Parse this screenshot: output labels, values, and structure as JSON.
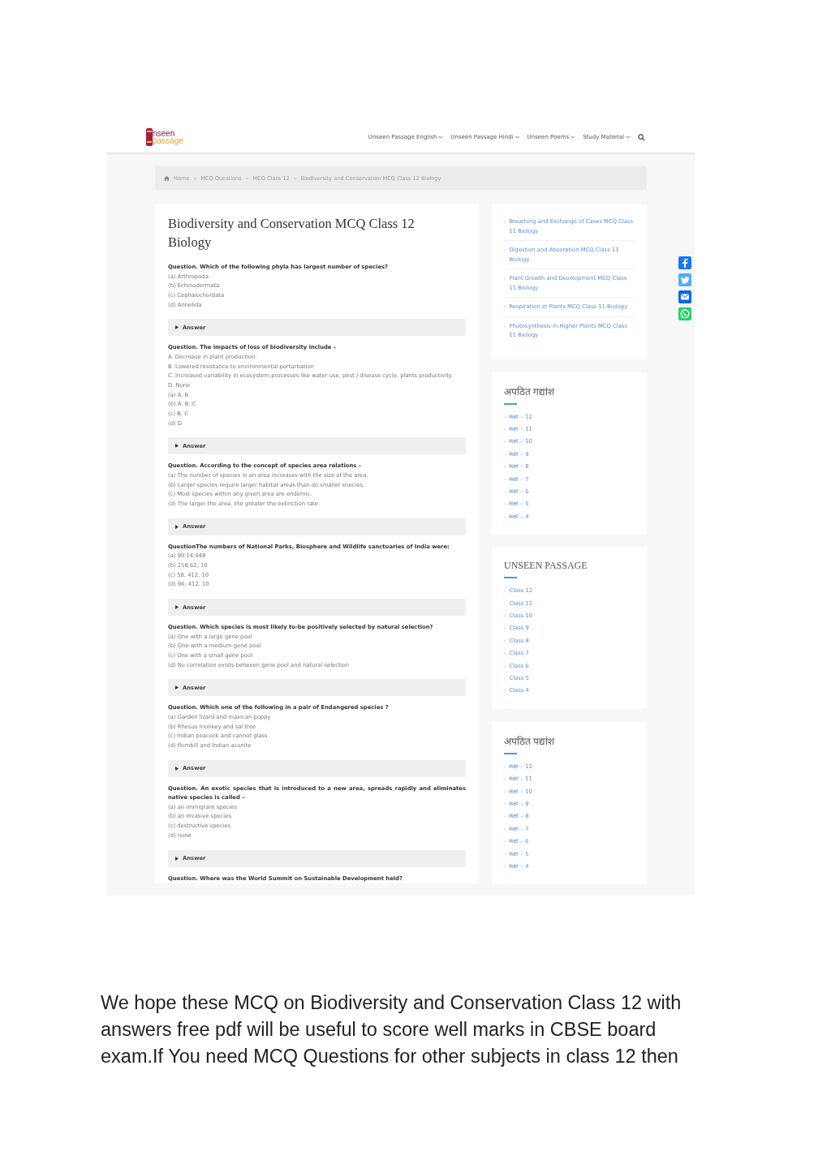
{
  "logo": {
    "part_1": "nseen",
    "part_2": "passage"
  },
  "nav": [
    {
      "label": "Unseen Passage English"
    },
    {
      "label": "Unseen Passage Hindi"
    },
    {
      "label": "Unseen Poems"
    },
    {
      "label": "Study Material"
    }
  ],
  "breadcrumb": {
    "separator": "»",
    "items": [
      "Home",
      "MCQ Questions",
      "MCQ Class 12",
      "Biodiversity and Conservation MCQ Class 12 Biology"
    ]
  },
  "article": {
    "title": "Biodiversity and Conservation MCQ Class 12 Biology",
    "questions": [
      {
        "question": "Question. Which of the following phyla has largest number of species?",
        "options": [
          "(a) Arthropoda",
          "(b) Echinodermata",
          "(c) Cephalochordata",
          "(d) Annelida"
        ],
        "answer_label": "Answer"
      },
      {
        "question": "Question. The impacts of loss of biodiversity include –",
        "options": [
          "A. Decrease in plant production.",
          "B. Lowered resistance to environmental perturbation",
          "C. Increased variability in ecosystem processes like water use, pest / disease cycle, plants productivity.",
          "D. None",
          "(a) A, B",
          "(b) A, B, C",
          "(c) B, C",
          "(d) D"
        ],
        "answer_label": "Answer"
      },
      {
        "question": "Question. According to the concept of species area relations –",
        "options": [
          "(a) The number of species in an area increases with the size of the area.",
          "(b) Larger species require larger habitat areas than do smaller snecies.",
          "(c) Most species within any given area are endemic.",
          "(d) The larger the area, the greater the extinction rate."
        ],
        "answer_label": "Answer"
      },
      {
        "question": "QuestionThe numbers of National Parks, Biosphere and Wildlife sanctuaries of India were:",
        "options": [
          "(a) 90,14,448",
          "(b) 158,62, 10",
          "(c) 58, 412, 10",
          "(d) 96, 412, 10"
        ],
        "answer_label": "Answer"
      },
      {
        "question": "Question. Which species is most likely to-be positively selected by natural selection?",
        "options": [
          "(a) One with a large gene pool",
          "(b) One with a medium gene pool",
          "(c) One with a small gene pool",
          "(d) No correlation exists between gene pool and natural selection"
        ],
        "answer_label": "Answer"
      },
      {
        "question": "Question. Which one of the following in a pair of Endangered species ?",
        "options": [
          "(a) Garden lizard and maxican poppy",
          "(b) Rhesus monkey and sal tree",
          "(c) Indian peacock and cannot glass",
          "(d) flornbill and Indian aconite"
        ],
        "answer_label": "Answer"
      },
      {
        "question": "Question. An exotic species that is introduced to a new area, spreads rapidly and eliminates native species is called –",
        "options": [
          "(a) an immigrant species",
          "(b) an invasive species",
          "(c) destructive species",
          "(d) none"
        ],
        "answer_label": "Answer"
      }
    ],
    "cut_question": "Question. Where was the World Summit on Sustainable Development held?"
  },
  "sidebar": [
    {
      "kind": "links",
      "marker": "-",
      "items": [
        "Breathing and Exchange of Cases MCQ Class 11 Biology",
        "Digestion and Absorption MCQ Class 11 Biology",
        "Plant Growth and Development MCQ Class 11 Biology",
        "Respiration in Plants MCQ Class 11 Biology",
        "Photosynthesis in Higher Plants MCQ Class 11 Biology"
      ]
    },
    {
      "kind": "list",
      "title": "अपठित गद्यांश",
      "marker": "-",
      "items": [
        "कक्षा – 12",
        "कक्षा – 11",
        "कक्षा – 10",
        "कक्षा – 9",
        "कक्षा – 8",
        "कक्षा – 7",
        "कक्षा – 6",
        "कक्षा – 5",
        "कक्षा – 4"
      ]
    },
    {
      "kind": "list",
      "title": "UNSEEN PASSAGE",
      "marker": "-",
      "items": [
        "Class 12",
        "Class 11",
        "Class 10",
        "Class 9",
        "Class 8",
        "Class 7",
        "Class 6",
        "Class 5",
        "Class 4"
      ]
    },
    {
      "kind": "list",
      "title": "अपठित पद्यांश",
      "marker": "-",
      "items": [
        "कक्षा – 12",
        "कक्षा – 11",
        "कक्षा – 10",
        "कक्षा – 9",
        "कक्षा – 8",
        "कक्षा – 7",
        "कक्षा – 6",
        "कक्षा – 5",
        "कक्षा – 4"
      ]
    }
  ],
  "share": [
    {
      "kind": "facebook"
    },
    {
      "kind": "twitter"
    },
    {
      "kind": "email"
    },
    {
      "kind": "whatsapp"
    }
  ],
  "caption": "We hope these MCQ on Biodiversity and Conservation Class 12 with answers free pdf will be useful to score well marks in CBSE board exam.If You need MCQ Questions for other subjects in class 12 then"
}
